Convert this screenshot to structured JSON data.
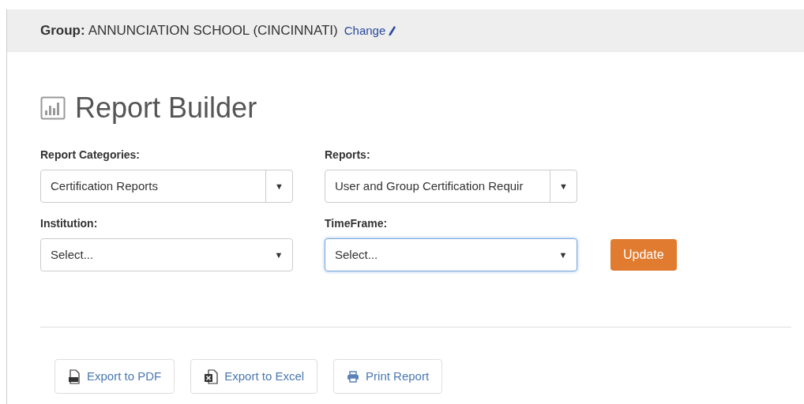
{
  "group_bar": {
    "label": "Group:",
    "name": "ANNUNCIATION SCHOOL (CINCINNATI)",
    "link": "Change"
  },
  "title": "Report Builder",
  "rows": [
    [
      {
        "label": "Report Categories:",
        "value": "Certification Reports",
        "kind": "split",
        "focused": false,
        "arrow": "▼"
      },
      {
        "label": "Reports:",
        "value": "User and Group Certification Requir",
        "kind": "split",
        "focused": false,
        "arrow": "▼"
      }
    ],
    [
      {
        "label": "Institution:",
        "value": "Select...",
        "kind": "plain",
        "focused": false,
        "arrow": "▼"
      },
      {
        "label": "TimeFrame:",
        "value": "Select...",
        "kind": "plain",
        "focused": true,
        "arrow": "▼"
      }
    ]
  ],
  "update_button": "Update",
  "exports": [
    {
      "label": "Export to PDF",
      "kind": "pdf"
    },
    {
      "label": "Export to Excel",
      "kind": "excel"
    },
    {
      "label": "Print Report",
      "kind": "print"
    }
  ]
}
